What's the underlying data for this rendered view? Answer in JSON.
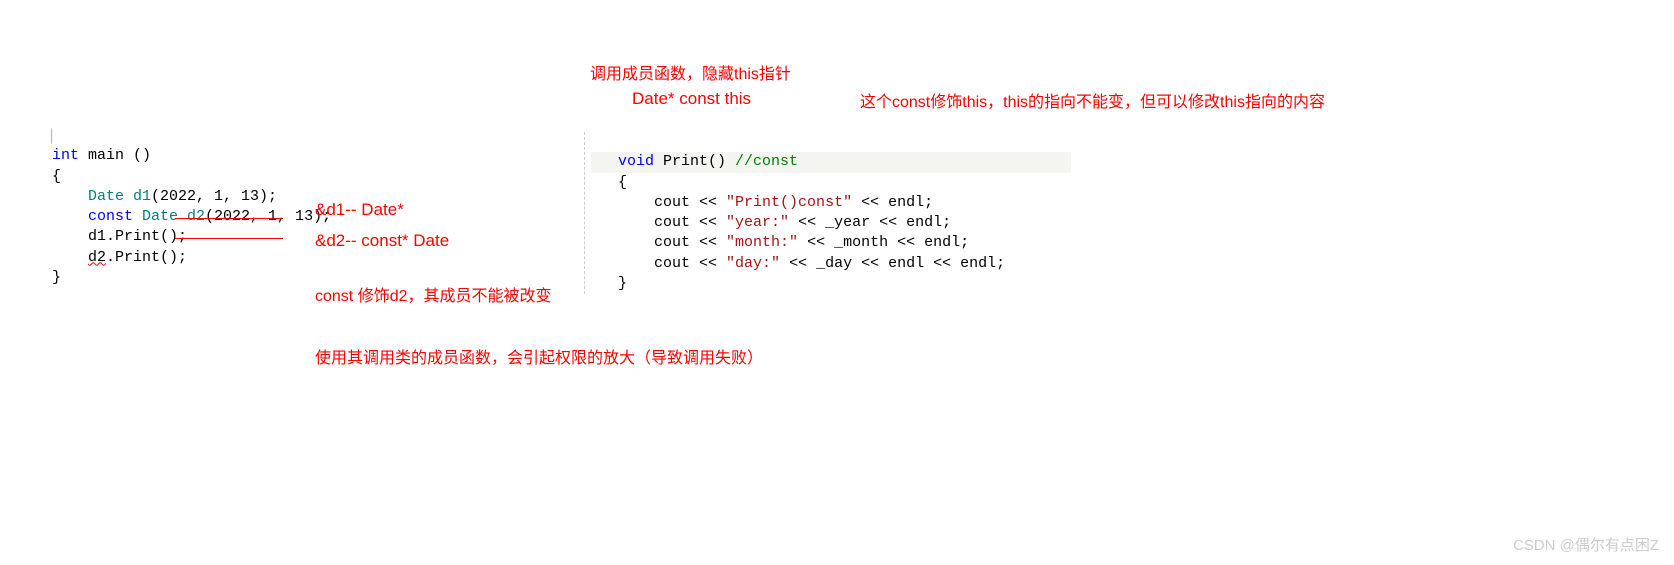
{
  "leftCode": {
    "l1a": "int",
    "l1b": " main ()",
    "l2": "{",
    "l3a": "    Date d1",
    "l3b": "(2022, 1, 13);",
    "l4a": "    ",
    "l4b": "const",
    "l4c": " Date d2",
    "l4d": "(2022, 1, 13);",
    "l5a": "    d1.",
    "l5b": "Print();",
    "l6a": "    ",
    "l6b": "d2",
    "l6c": ".",
    "l6d": "Print();",
    "l7": "}"
  },
  "rightCode": {
    "l1a": "void",
    "l1b": " Print() ",
    "l1c": "//const",
    "l2": "{",
    "l3a": "    cout << ",
    "l3b": "\"Print()const\"",
    "l3c": " << endl;",
    "l4a": "    cout << ",
    "l4b": "\"year:\"",
    "l4c": " << _year << endl;",
    "l5a": "    cout << ",
    "l5b": "\"month:\"",
    "l5c": " << _month << endl;",
    "l6a": "    cout << ",
    "l6b": "\"day:\"",
    "l6c": " << _day << endl << endl;",
    "l7": "}"
  },
  "annotations": {
    "top1": "调用成员函数，隐藏this指针",
    "top2": "Date* const this",
    "top3": "这个const修饰this，this的指向不能变，但可以修改this指向的内容",
    "mid1": "&d1-- Date*",
    "mid2": "&d2-- const* Date",
    "mid3": "const 修饰d2，其成员不能被改变",
    "bottom": "使用其调用类的成员函数，会引起权限的放大（导致调用失败）"
  },
  "watermark": "CSDN @偶尔有点困Z"
}
